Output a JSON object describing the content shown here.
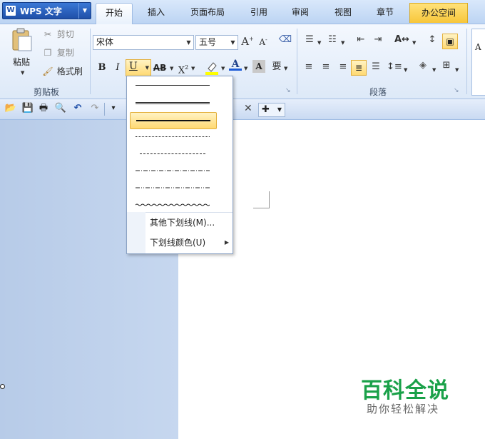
{
  "app": {
    "title": "WPS 文字",
    "logo": "W"
  },
  "tabs": [
    {
      "label": "开始",
      "active": true
    },
    {
      "label": "插入"
    },
    {
      "label": "页面布局"
    },
    {
      "label": "引用"
    },
    {
      "label": "审阅"
    },
    {
      "label": "视图"
    },
    {
      "label": "章节"
    },
    {
      "label": "办公空间",
      "highlight": true
    }
  ],
  "clipboard": {
    "paste": "粘贴",
    "cut": "剪切",
    "copy": "复制",
    "format_painter": "格式刷",
    "group_label": "剪贴板"
  },
  "font": {
    "name": "宋体",
    "size": "五号",
    "grow": "A",
    "shrink": "A",
    "bold": "B",
    "italic": "I",
    "underline": "U",
    "strike": "AB",
    "superscript": "X",
    "superscript_mark": "2",
    "font_color": "A",
    "shade": "A",
    "phonetic": "要"
  },
  "paragraph": {
    "group_label": "段落"
  },
  "underline_menu": {
    "more": "其他下划线(M)...",
    "color": "下划线颜色(U)"
  },
  "watermark": {
    "title": "百科全说",
    "subtitle": "助你轻松解决"
  },
  "colors": {
    "accent_blue": "#1f4fa8",
    "tab_highlight": "#f7c63a",
    "selected_option": "#ffd972",
    "watermark_green": "#1aa149"
  },
  "icons": {
    "paste": "clipboard-icon",
    "cut": "scissors-icon",
    "copy": "copy-icon",
    "format_painter": "brush-icon",
    "open": "folder-icon",
    "save": "save-icon",
    "print": "print-icon",
    "preview": "preview-icon",
    "undo": "undo-icon",
    "redo": "redo-icon",
    "close": "close-icon",
    "add": "plus-icon"
  }
}
